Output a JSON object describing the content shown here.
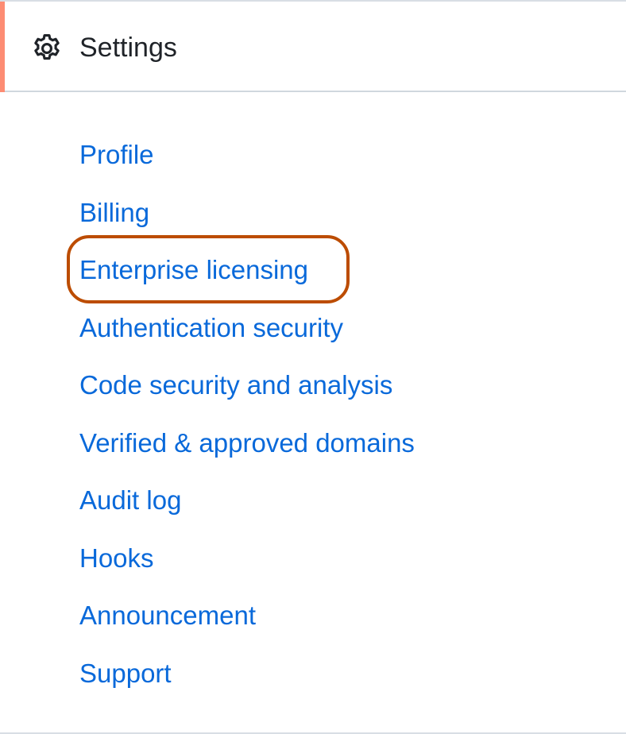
{
  "header": {
    "title": "Settings",
    "icon": "gear-icon",
    "accent_color": "#fd8c73"
  },
  "nav": {
    "items": [
      {
        "label": "Profile"
      },
      {
        "label": "Billing"
      },
      {
        "label": "Enterprise licensing",
        "highlighted": true
      },
      {
        "label": "Authentication security"
      },
      {
        "label": "Code security and analysis"
      },
      {
        "label": "Verified & approved domains"
      },
      {
        "label": "Audit log"
      },
      {
        "label": "Hooks"
      },
      {
        "label": "Announcement"
      },
      {
        "label": "Support"
      }
    ],
    "link_color": "#0969da",
    "highlight_color": "#bc4c00"
  }
}
